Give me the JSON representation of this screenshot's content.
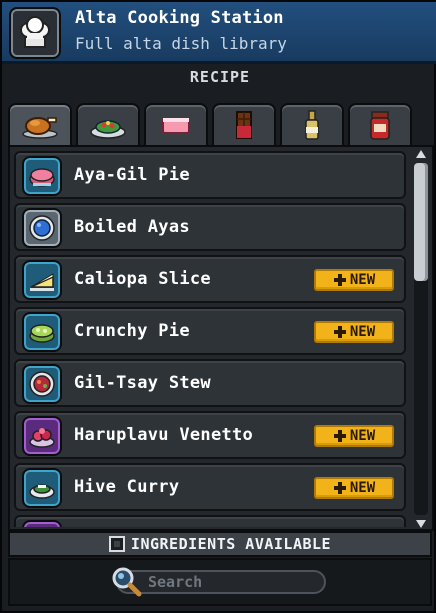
{
  "header": {
    "title": "Alta Cooking Station",
    "subtitle": "Full alta dish library",
    "icon": "chef-hat-icon"
  },
  "section_label": "RECIPE",
  "tabs": [
    {
      "icon": "roast-chicken-icon",
      "active": true
    },
    {
      "icon": "salad-plate-icon",
      "active": false
    },
    {
      "icon": "ham-slice-icon",
      "active": false
    },
    {
      "icon": "chocolate-bar-icon",
      "active": false
    },
    {
      "icon": "bottle-icon",
      "active": false
    },
    {
      "icon": "jam-jar-icon",
      "active": false
    }
  ],
  "recipes": [
    {
      "label": "Aya-Gil Pie",
      "icon": "pie-icon",
      "frame": "blue",
      "new": false
    },
    {
      "label": "Boiled Ayas",
      "icon": "blue-bowl-icon",
      "frame": "blue",
      "new": false
    },
    {
      "label": "Caliopa Slice",
      "icon": "cake-slice-icon",
      "frame": "blue",
      "new": true
    },
    {
      "label": "Crunchy Pie",
      "icon": "green-pie-icon",
      "frame": "blue",
      "new": true
    },
    {
      "label": "Gil-Tsay Stew",
      "icon": "stew-icon",
      "frame": "blue",
      "new": false
    },
    {
      "label": "Haruplavu Venetto",
      "icon": "berry-dish-icon",
      "frame": "purple",
      "new": true
    },
    {
      "label": "Hive Curry",
      "icon": "curry-icon",
      "frame": "blue",
      "new": true
    }
  ],
  "new_badge_label": "NEW",
  "scrollbar": {
    "position_fraction": 0.0
  },
  "ingredients_filter": {
    "label": "INGREDIENTS AVAILABLE",
    "checked": false
  },
  "search": {
    "placeholder": "Search",
    "value": ""
  },
  "colors": {
    "accent_header": "#224f7e",
    "badge": "#f2b31a",
    "panel": "#2e3338"
  }
}
